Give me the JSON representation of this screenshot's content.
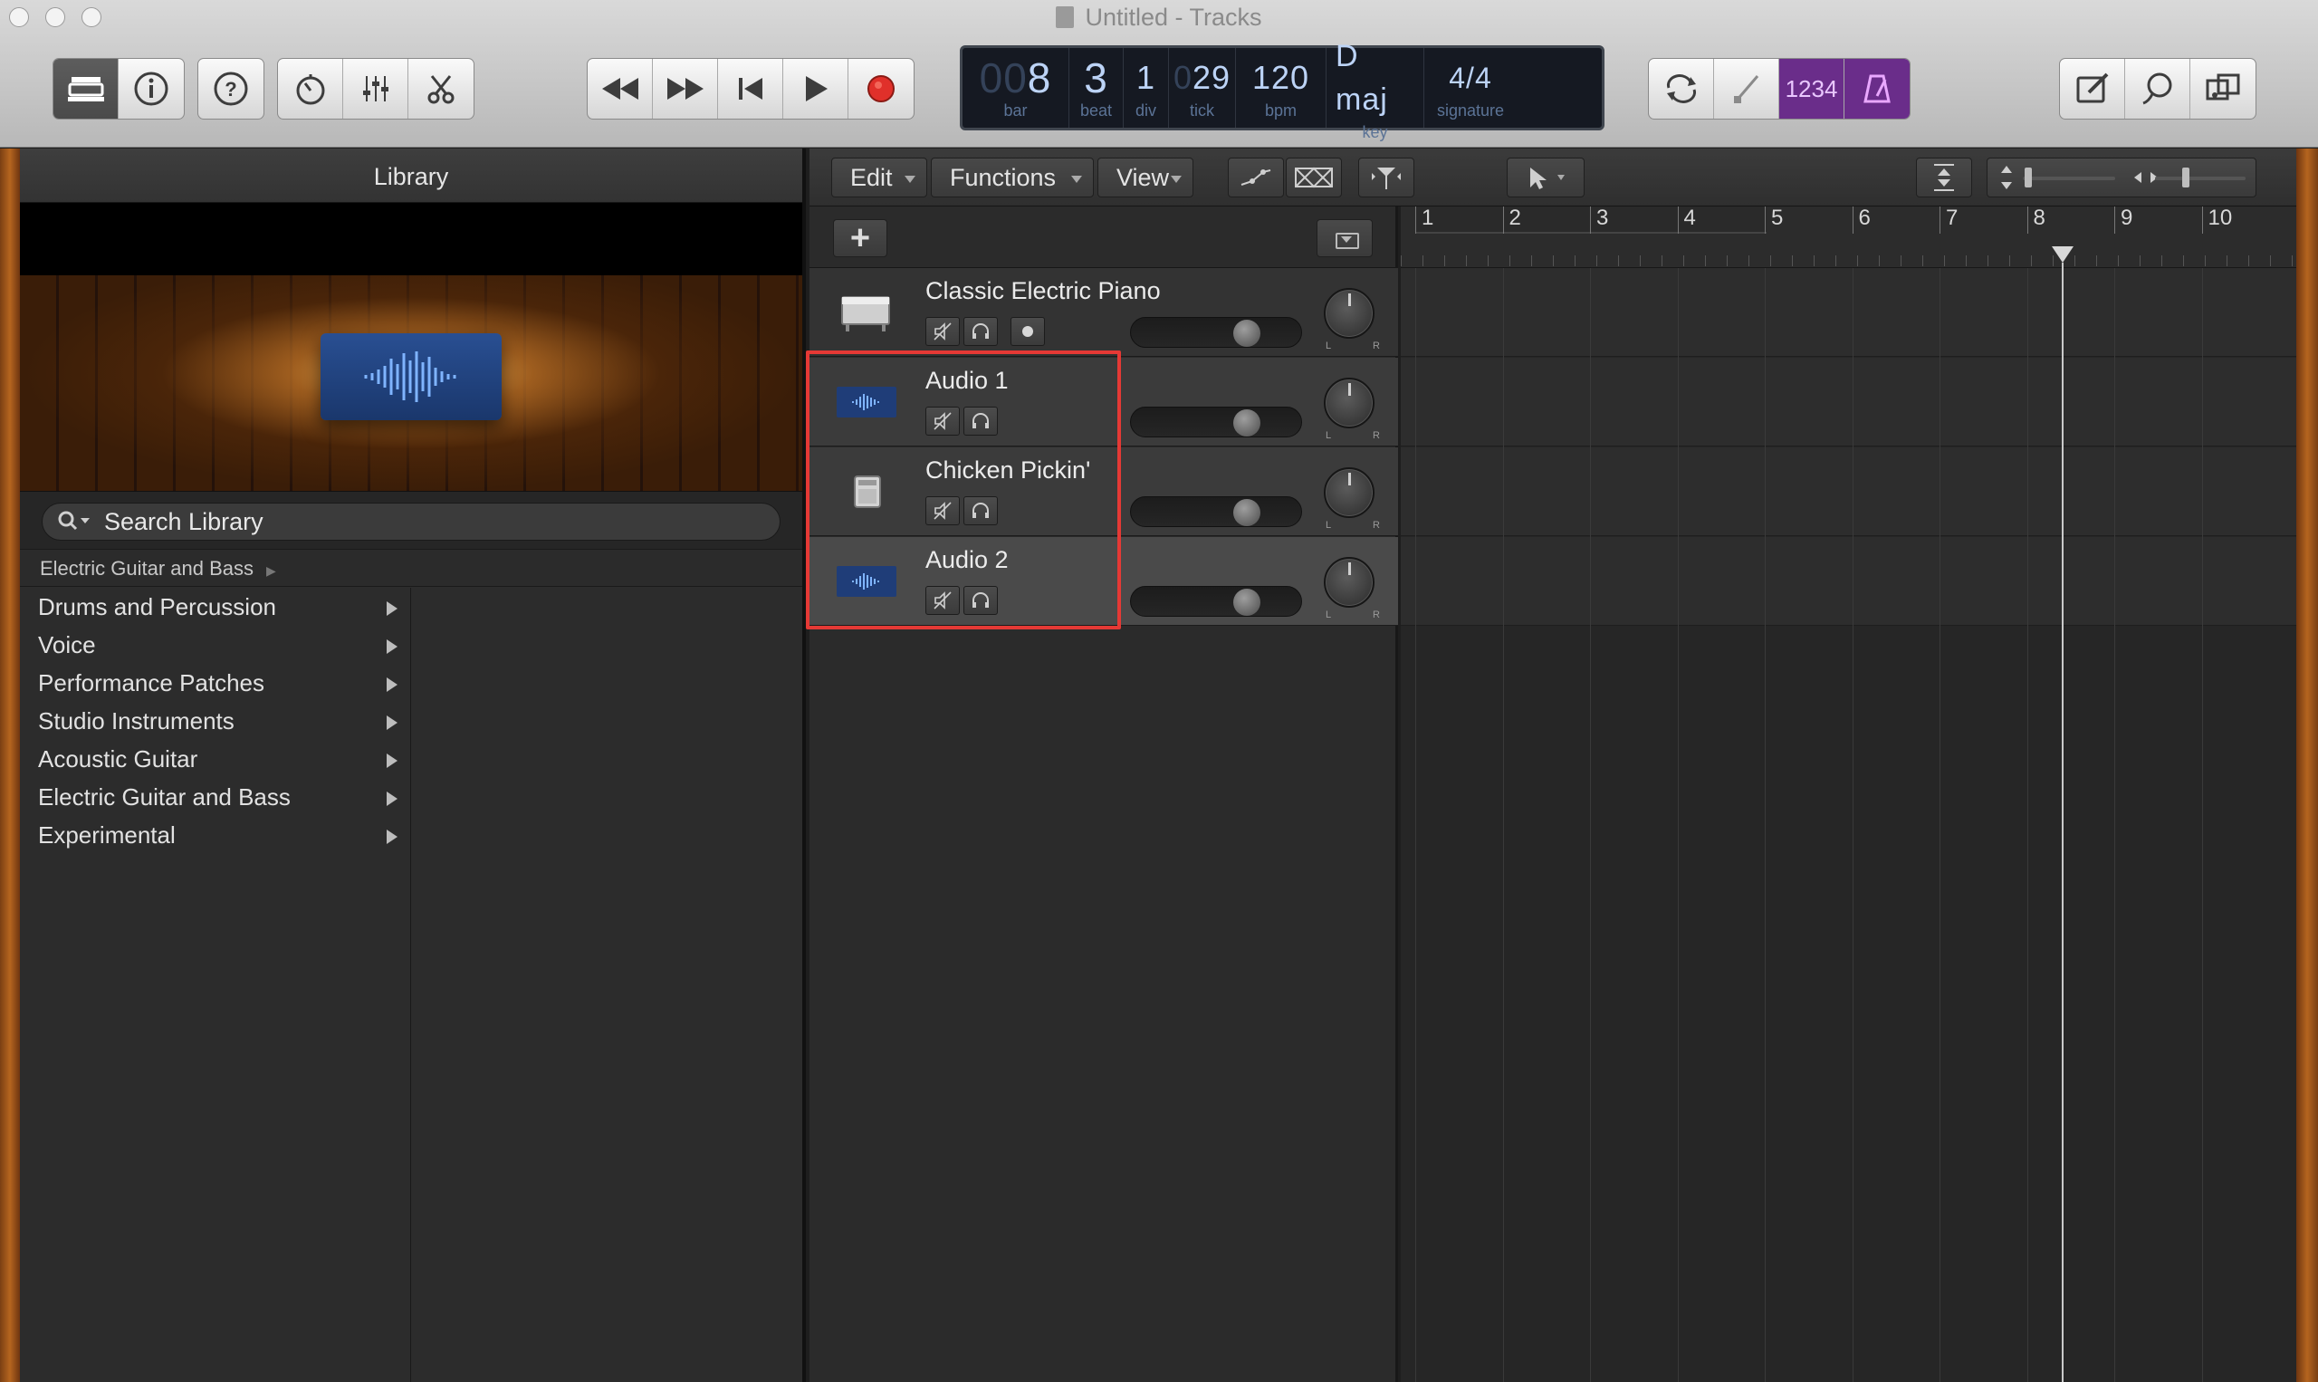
{
  "window": {
    "title": "Untitled - Tracks"
  },
  "toolbar": {
    "left_icons": [
      "library-icon",
      "info-icon",
      "help-icon",
      "smart-controls-icon",
      "mixer-icon",
      "editors-icon"
    ],
    "transport_icons": [
      "rewind-icon",
      "fast-forward-icon",
      "go-to-beginning-icon",
      "play-icon",
      "record-icon"
    ],
    "right_icons": [
      "cycle-icon",
      "tuner-icon",
      "count-in-icon",
      "metronome-icon"
    ],
    "count_in_label": "1234",
    "far_right_icons": [
      "notepad-icon",
      "loop-browser-icon",
      "media-browser-icon"
    ]
  },
  "lcd": {
    "bar_dim": "00",
    "bar": "8",
    "bar_label": "bar",
    "beat": "3",
    "beat_label": "beat",
    "div": "1",
    "div_label": "div",
    "tick_dim": "0",
    "tick": "29",
    "tick_label": "tick",
    "bpm": "120",
    "bpm_label": "bpm",
    "key": "D maj",
    "key_label": "key",
    "signature": "4/4",
    "signature_label": "signature"
  },
  "library": {
    "title": "Library",
    "search_placeholder": "Search Library",
    "breadcrumb": "Electric Guitar and Bass",
    "categories": [
      {
        "label": "Drums and Percussion"
      },
      {
        "label": "Voice"
      },
      {
        "label": "Performance Patches"
      },
      {
        "label": "Studio Instruments"
      },
      {
        "label": "Acoustic Guitar"
      },
      {
        "label": "Electric Guitar and Bass"
      },
      {
        "label": "Experimental"
      }
    ]
  },
  "tracks_menu": {
    "edit": "Edit",
    "functions": "Functions",
    "view": "View"
  },
  "tracks": [
    {
      "name": "Classic Electric Piano",
      "icon": "piano-icon",
      "volume": 0.72,
      "has_record": true
    },
    {
      "name": "Audio 1",
      "icon": "waveform-icon",
      "volume": 0.72,
      "has_record": false
    },
    {
      "name": "Chicken Pickin'",
      "icon": "amp-icon",
      "volume": 0.72,
      "has_record": false
    },
    {
      "name": "Audio 2",
      "icon": "waveform-icon",
      "volume": 0.72,
      "has_record": false
    }
  ],
  "ruler": {
    "bars": [
      "1",
      "2",
      "3",
      "4",
      "5",
      "6",
      "7",
      "8",
      "9",
      "10"
    ],
    "playhead_bar": 8.4
  },
  "colors": {
    "record": "#e0302a",
    "count_in": "#6a2d8a",
    "lcd_text": "#bcd3f6",
    "highlight": "#e53935"
  }
}
